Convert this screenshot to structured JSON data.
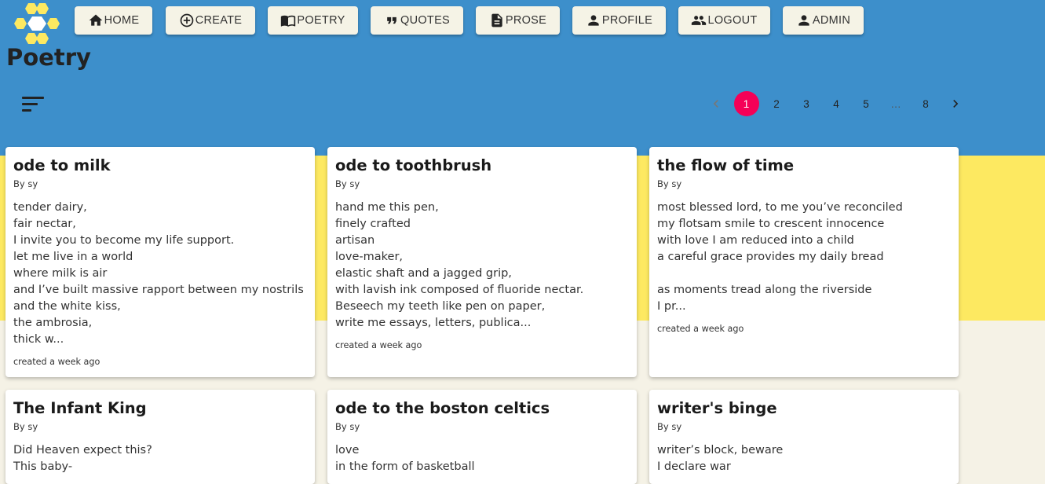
{
  "header": {
    "nav": [
      {
        "label": "HOME",
        "icon": "home-icon"
      },
      {
        "label": "CREATE",
        "icon": "add-circle-icon"
      },
      {
        "label": "POETRY",
        "icon": "book-icon"
      },
      {
        "label": "QUOTES",
        "icon": "quote-icon"
      },
      {
        "label": "PROSE",
        "icon": "document-icon"
      },
      {
        "label": "PROFILE",
        "icon": "person-icon"
      },
      {
        "label": "LOGOUT",
        "icon": "people-icon"
      },
      {
        "label": "ADMIN",
        "icon": "person-icon"
      }
    ],
    "page_title": "Poetry"
  },
  "toolbar": {
    "sort_icon": "sort-icon"
  },
  "pagination": {
    "pages": [
      "1",
      "2",
      "3",
      "4",
      "5",
      "…",
      "8"
    ],
    "current": "1",
    "prev_icon": "chevron-left-icon",
    "next_icon": "chevron-right-icon"
  },
  "colors": {
    "header_bg": "#3d8fcb",
    "band_yellow": "#fde961",
    "band_cream": "#f5f2e6",
    "active_page": "#f50057",
    "logo_yellow": "#fde961"
  },
  "cards": [
    {
      "title": "ode to milk",
      "author": "By sy",
      "lines": [
        "tender dairy,",
        "fair nectar,",
        "I invite you to become my life support.",
        "let me live in a world",
        "where milk is air",
        "and I’ve built massive rapport between my nostrils",
        "and the white kiss,",
        "the ambrosia,",
        "thick w..."
      ],
      "date": "created a week ago"
    },
    {
      "title": "ode to toothbrush",
      "author": "By sy",
      "lines": [
        "hand me this pen,",
        "finely crafted",
        "artisan",
        "love-maker,",
        "elastic shaft and a jagged grip,",
        "with lavish ink composed of fluoride nectar.",
        "Beseech my teeth like pen on paper,",
        "write me essays, letters, publica..."
      ],
      "date": "created a week ago"
    },
    {
      "title": "the flow of time",
      "author": "By sy",
      "lines": [
        "most blessed lord, to me you’ve reconciled",
        "my flotsam smile to crescent innocence",
        "with love I am reduced into a child",
        "a careful grace provides my daily bread",
        "",
        "as moments tread along the riverside",
        "I pr..."
      ],
      "date": "created a week ago"
    },
    {
      "title": "The Infant King",
      "author": "By sy",
      "lines": [
        "Did Heaven expect this?",
        "This baby-"
      ],
      "date": ""
    },
    {
      "title": "ode to the boston celtics",
      "author": "By sy",
      "lines": [
        "love",
        "in the form of basketball"
      ],
      "date": ""
    },
    {
      "title": "writer's binge",
      "author": "By sy",
      "lines": [
        "writer’s block, beware",
        "I declare war"
      ],
      "date": ""
    }
  ]
}
